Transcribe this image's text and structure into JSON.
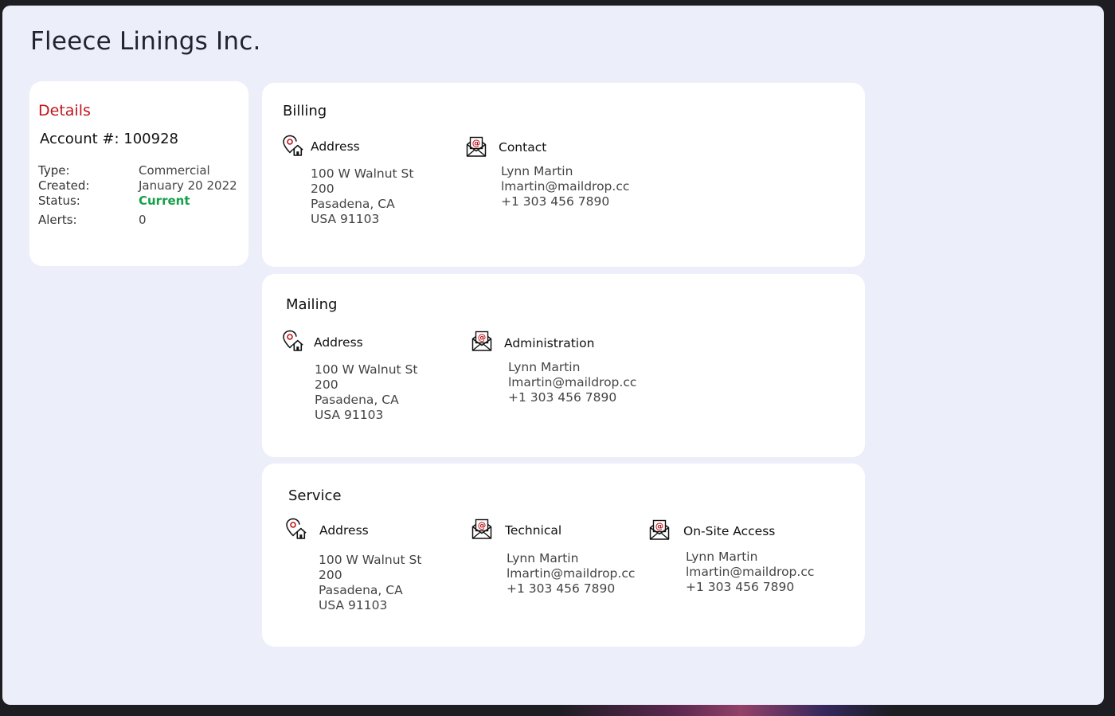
{
  "page": {
    "title": "Fleece Linings Inc."
  },
  "colors": {
    "brand_red": "#c0141c",
    "status_green": "#14a04a",
    "window_bg": "#eceff9"
  },
  "details": {
    "header": "Details",
    "account_label": "Account #: 100928",
    "fields": [
      {
        "label": "Type:",
        "value": "Commercial"
      },
      {
        "label": "Created:",
        "value": "January 20 2022"
      },
      {
        "label": "Status:",
        "value": "Current"
      },
      {
        "label": "Alerts:",
        "value": "0"
      }
    ]
  },
  "billing": {
    "title": "Billing",
    "address": {
      "icon": "location-home-icon",
      "label": "Address",
      "lines": [
        "100 W Walnut St",
        "200",
        "Pasadena, CA",
        "USA 91103"
      ]
    },
    "contact": {
      "icon": "email-envelope-icon",
      "label": "Contact",
      "lines": [
        "Lynn Martin",
        "lmartin@maildrop.cc",
        "+1 303 456 7890"
      ]
    }
  },
  "mailing": {
    "title": "Mailing",
    "address": {
      "icon": "location-home-icon",
      "label": "Address",
      "lines": [
        "100 W Walnut St",
        "200",
        "Pasadena, CA",
        "USA 91103"
      ]
    },
    "contact": {
      "icon": "email-envelope-icon",
      "label": "Administration",
      "lines": [
        "Lynn Martin",
        "lmartin@maildrop.cc",
        "+1 303 456 7890"
      ]
    }
  },
  "service": {
    "title": "Service",
    "address": {
      "icon": "location-home-icon",
      "label": "Address",
      "lines": [
        "100 W Walnut St",
        "200",
        "Pasadena, CA",
        "USA 91103"
      ]
    },
    "technical": {
      "icon": "email-envelope-icon",
      "label": "Technical",
      "lines": [
        "Lynn Martin",
        "lmartin@maildrop.cc",
        "+1 303 456 7890"
      ]
    },
    "onsite": {
      "icon": "email-envelope-icon",
      "label": "On-Site Access",
      "lines": [
        "Lynn Martin",
        "lmartin@maildrop.cc",
        "+1 303 456 7890"
      ]
    }
  }
}
